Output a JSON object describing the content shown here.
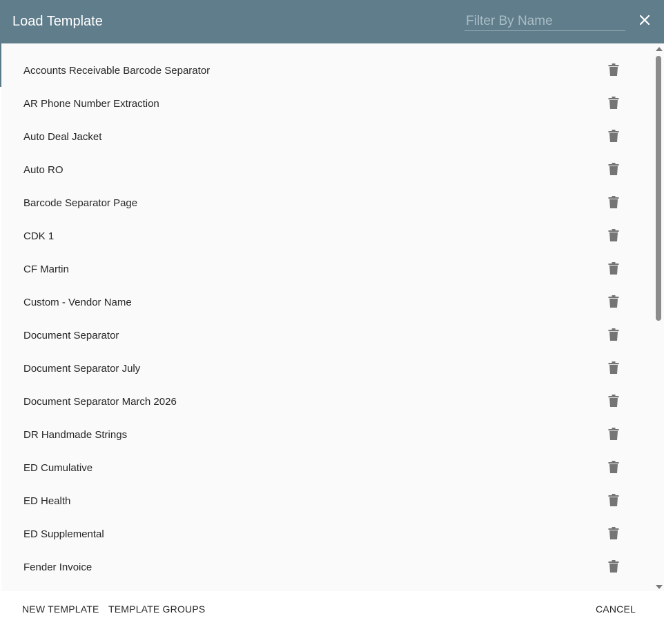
{
  "header": {
    "title": "Load Template",
    "filter_placeholder": "Filter By Name",
    "filter_value": ""
  },
  "templates": [
    "Accounts Receivable Barcode Separator",
    "AR Phone Number Extraction",
    "Auto Deal Jacket",
    "Auto RO",
    "Barcode Separator Page",
    "CDK 1",
    "CF Martin",
    "Custom - Vendor Name",
    "Document Separator",
    "Document Separator July",
    "Document Separator March 2026",
    "DR Handmade Strings",
    "ED Cumulative",
    "ED Health",
    "ED Supplemental",
    "Fender Invoice"
  ],
  "icons": {
    "close": "close-icon",
    "delete": "trash-icon"
  },
  "footer": {
    "new_template_label": "NEW TEMPLATE",
    "template_groups_label": "TEMPLATE GROUPS",
    "cancel_label": "CANCEL"
  },
  "colors": {
    "header_bg": "#607d8b",
    "list_bg": "#fafafa",
    "icon": "#757575",
    "text": "#262626"
  }
}
